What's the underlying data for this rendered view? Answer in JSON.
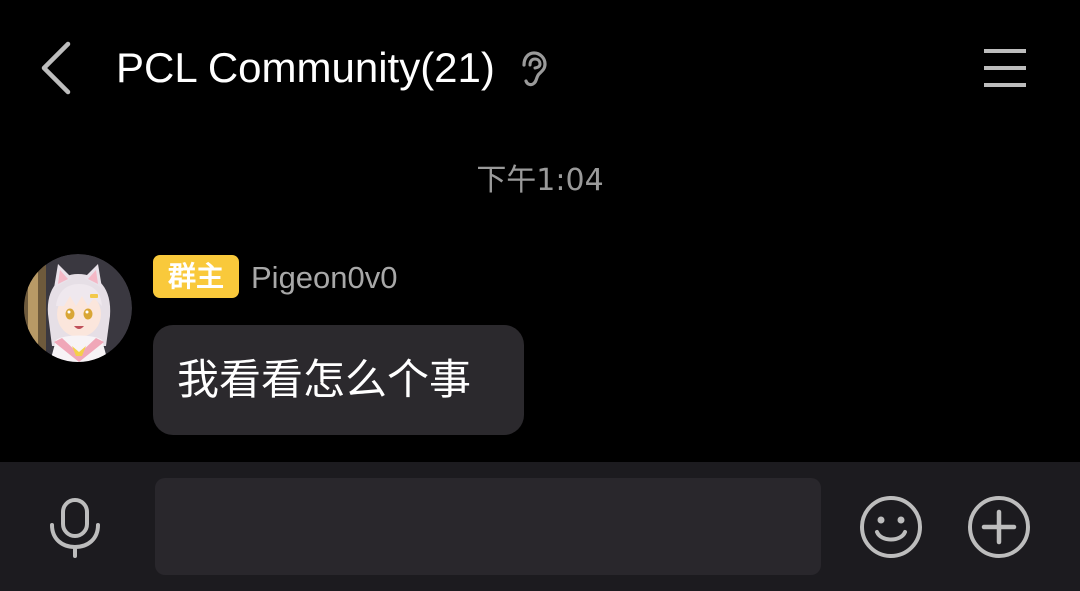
{
  "header": {
    "title": "PCL Community(21)",
    "back_icon": "chevron-left-icon",
    "mode_icon": "ear-icon",
    "menu_icon": "hamburger-menu-icon"
  },
  "chat": {
    "timestamp": "下午1:04",
    "messages": [
      {
        "role_badge": "群主",
        "sender": "Pigeon0v0",
        "text": "我看看怎么个事",
        "avatar_icon": "anime-avatar"
      }
    ]
  },
  "composer": {
    "input_value": "",
    "placeholder": "",
    "voice_icon": "microphone-icon",
    "emoji_icon": "smiley-icon",
    "more_icon": "plus-circle-icon"
  },
  "colors": {
    "background": "#000000",
    "badge": "#f9c93b",
    "bubble": "#2b292d",
    "bottom_bar": "#1c1b1f",
    "input": "#29272c",
    "muted_text": "#9a9a9a",
    "icon_gray": "#bdbdbd"
  }
}
